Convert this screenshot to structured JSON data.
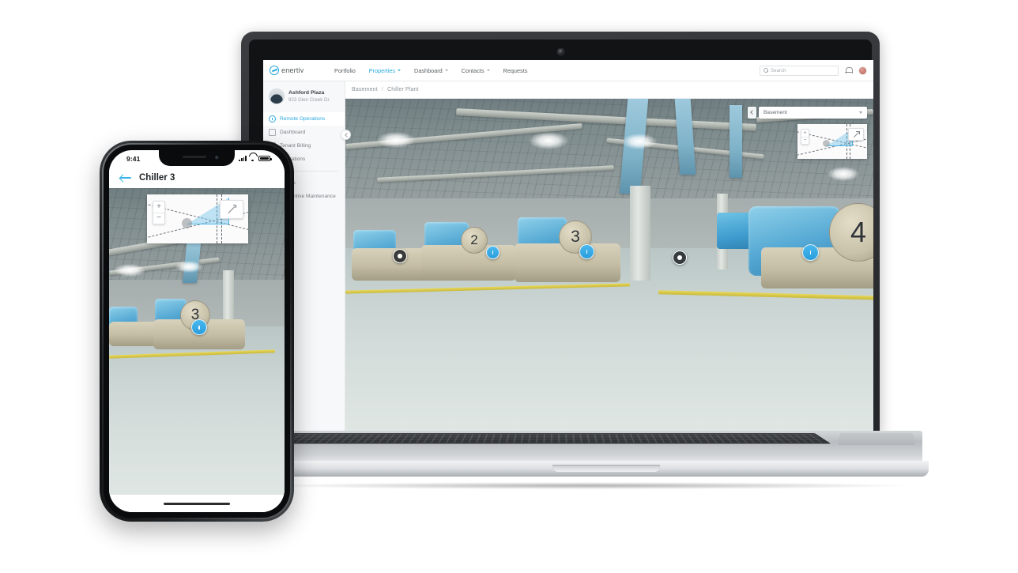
{
  "brand": {
    "name": "enertiv",
    "logo_icon": "enertiv-circle-e-logo",
    "accent": "#2aa8e0"
  },
  "laptop": {
    "topnav": {
      "items": [
        {
          "label": "Portfolio",
          "has_caret": false,
          "active": false
        },
        {
          "label": "Properties",
          "has_caret": true,
          "active": true
        },
        {
          "label": "Dashboard",
          "has_caret": true,
          "active": false
        },
        {
          "label": "Contacts",
          "has_caret": true,
          "active": false
        },
        {
          "label": "Requests",
          "has_caret": false,
          "active": false
        }
      ],
      "search_placeholder": "Search",
      "search_value": "",
      "search_icon": "magnifier-icon",
      "notification_icon": "bell-icon",
      "avatar_icon": "user-avatar"
    },
    "breadcrumb": {
      "parent": "Basement",
      "separator": "/",
      "current": "Chiller Plant"
    },
    "sidebar": {
      "property_name": "Ashford Plaza",
      "property_address": "923 Glen Creek Dr.",
      "property_icon": "building-globe-icon",
      "collapse_icon": "chevron-left-icon",
      "items": [
        {
          "label": "Remote Operations",
          "icon": "gauge-icon",
          "active": true
        },
        {
          "label": "Dashboard",
          "icon": "square-icon",
          "active": false
        },
        {
          "label": "Tenant Billing",
          "icon": "billing-icon",
          "active": false
        },
        {
          "label": "Operations",
          "icon": "operations-icon",
          "active": false
        }
      ],
      "items_lower": [
        {
          "label": "Assets",
          "icon": "assets-icon",
          "active": false
        },
        {
          "label": "Preventive Maintenance",
          "icon": "wrench-icon",
          "active": false
        }
      ]
    },
    "viewer": {
      "floor_selector": {
        "value": "Basement",
        "caret_icon": "chevron-down-icon",
        "collapse_icon": "chevron-left-icon"
      },
      "minimap": {
        "zoom_in_label": "+",
        "zoom_out_label": "−",
        "expand_icon": "expand-arrow-icon",
        "position_dot": "current-position-dot",
        "view_cone": "camera-view-cone"
      },
      "equipment": [
        {
          "number": "2",
          "pin_icon": "info-pin-icon"
        },
        {
          "number": "3",
          "pin_icon": "info-pin-icon"
        },
        {
          "number": "4",
          "pin_icon": "info-pin-icon"
        }
      ],
      "waypoints": [
        "navigation-waypoint",
        "navigation-waypoint"
      ]
    }
  },
  "phone": {
    "status_bar": {
      "time": "9:41",
      "signal_icon": "cellular-signal-icon",
      "wifi_icon": "wifi-icon",
      "battery_icon": "battery-full-icon"
    },
    "appbar": {
      "back_icon": "back-arrow-icon",
      "title": "Chiller 3"
    },
    "viewer": {
      "minimap": {
        "zoom_in_label": "+",
        "zoom_out_label": "−",
        "expand_icon": "expand-arrow-icon",
        "position_dot": "current-position-dot",
        "view_cone": "camera-view-cone"
      },
      "equipment": [
        {
          "number": "3",
          "pin_icon": "info-pin-icon"
        }
      ]
    },
    "home_indicator": "home-indicator-bar"
  }
}
